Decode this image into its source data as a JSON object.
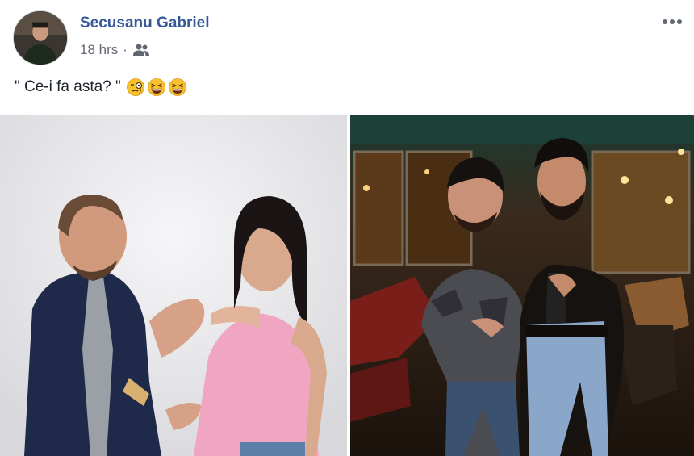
{
  "post": {
    "author_name": "Secusanu Gabriel",
    "timestamp": "18 hrs",
    "separator": "·",
    "audience_icon": "friends-icon",
    "more_icon": "more-options-icon",
    "text": "\" Ce-i fa asta? \"",
    "emojis": [
      "monocle-face-emoji",
      "grinning-squinting-face-emoji",
      "grinning-squinting-face-emoji"
    ]
  },
  "colors": {
    "author_link": "#365899",
    "meta_text": "#616770",
    "body_text": "#1d2129"
  }
}
